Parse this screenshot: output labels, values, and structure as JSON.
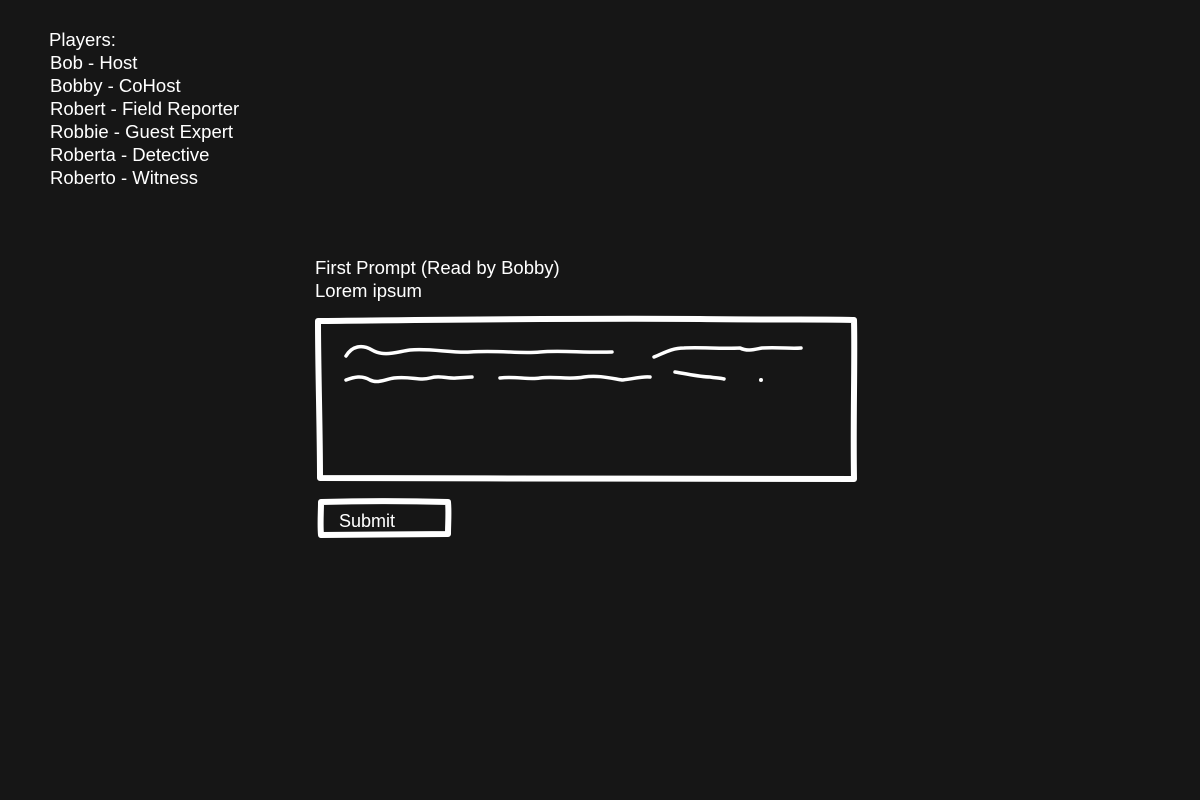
{
  "players": {
    "heading": "Players:",
    "list": [
      "Bob - Host",
      "Bobby - CoHost",
      "Robert - Field Reporter",
      "Robbie - Guest Expert",
      "Roberta - Detective",
      "Roberto - Witness"
    ]
  },
  "prompt": {
    "title": "First Prompt (Read by Bobby)",
    "text": "Lorem ipsum"
  },
  "answer_box": {
    "content": "scribbled placeholder text"
  },
  "submit": {
    "label": "Submit"
  },
  "colors": {
    "background": "#161616",
    "foreground": "#ffffff"
  }
}
